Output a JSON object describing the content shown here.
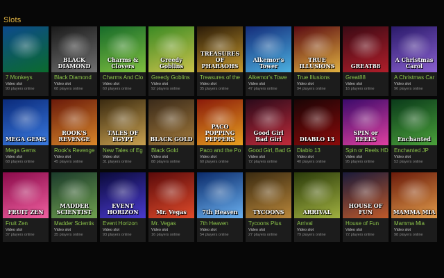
{
  "section_title": "Slots",
  "games": [
    {
      "name": "7 Monkeys",
      "logo": "",
      "type": "Video slot",
      "players": "90 players online",
      "bg": [
        "#0c4a8c",
        "#0b6b2d"
      ]
    },
    {
      "name": "Black Diamond",
      "logo": "BLACK DIAMOND",
      "type": "Video slot",
      "players": "68 players online",
      "bg": [
        "#1a1a1a",
        "#707070"
      ]
    },
    {
      "name": "Charms And Clo",
      "logo": "Charms & Clovers",
      "type": "Video slot",
      "players": "60 players online",
      "bg": [
        "#176b2a",
        "#7fbf3f"
      ]
    },
    {
      "name": "Greedy Goblins",
      "logo": "Greedy Goblins",
      "type": "Video slot",
      "players": "92 players online",
      "bg": [
        "#3b8a24",
        "#c9c24a"
      ]
    },
    {
      "name": "Treasures of the",
      "logo": "TREASURES OF PHARAOHS",
      "type": "Video slot",
      "players": "35 players online",
      "bg": [
        "#2a1a08",
        "#c79a2e"
      ]
    },
    {
      "name": "Alkemor's Towe",
      "logo": "Alkemor's Tower",
      "type": "Video slot",
      "players": "47 players online",
      "bg": [
        "#142c7a",
        "#4bb0e0"
      ]
    },
    {
      "name": "True Illusions",
      "logo": "TRUE ILLUSIONS",
      "type": "Video slot",
      "players": "94 players online",
      "bg": [
        "#5a0a12",
        "#e0b040"
      ]
    },
    {
      "name": "Great88",
      "logo": "GREAT88",
      "type": "Video slot",
      "players": "16 players online",
      "bg": [
        "#3a0a14",
        "#b01e2a"
      ]
    },
    {
      "name": "A Christmas Car",
      "logo": "A Christmas Carol",
      "type": "Video slot",
      "players": "96 players online",
      "bg": [
        "#2a1a6a",
        "#8a60d0"
      ]
    },
    {
      "name": "Mega Gems",
      "logo": "MEGA GEMS",
      "type": "Video slot",
      "players": "68 players online",
      "bg": [
        "#0a2a7a",
        "#3a7ae0"
      ]
    },
    {
      "name": "Rook's Revenge",
      "logo": "ROOK'S REVENGE",
      "type": "Video slot",
      "players": "45 players online",
      "bg": [
        "#6a1a0a",
        "#d8862a"
      ]
    },
    {
      "name": "New Tales of Eg",
      "logo": "TALES OF EGYPT",
      "type": "Video slot",
      "players": "31 players online",
      "bg": [
        "#3a2a10",
        "#c8a050"
      ]
    },
    {
      "name": "Black Gold",
      "logo": "BLACK GOLD",
      "type": "Video slot",
      "players": "88 players online",
      "bg": [
        "#3a2a1a",
        "#a0783a"
      ]
    },
    {
      "name": "Paco and the Po",
      "logo": "PACO POPPING PEPPERS",
      "type": "Video slot",
      "players": "60 players online",
      "bg": [
        "#8a1a0a",
        "#e8a020"
      ]
    },
    {
      "name": "Good Girl, Bad G",
      "logo": "Good Girl Bad Girl",
      "type": "Video slot",
      "players": "72 players online",
      "bg": [
        "#2a0a1a",
        "#c02a3a"
      ]
    },
    {
      "name": "Diablo 13",
      "logo": "DIABLO 13",
      "type": "Video slot",
      "players": "40 players online",
      "bg": [
        "#1a0506",
        "#8a0a0a"
      ]
    },
    {
      "name": "Spin or Reels HD",
      "logo": "SPIN or REELS",
      "type": "Video slot",
      "players": "95 players online",
      "bg": [
        "#3a0a6a",
        "#e040a0"
      ]
    },
    {
      "name": "Enchanted JP",
      "logo": "Enchanted",
      "type": "Video slot",
      "players": "53 players online",
      "bg": [
        "#0a3a1a",
        "#4aa03a"
      ]
    },
    {
      "name": "Fruit Zen",
      "logo": "FRUIT ZEN",
      "type": "Video slot",
      "players": "37 players online",
      "bg": [
        "#8a0a4a",
        "#f060a0"
      ]
    },
    {
      "name": "Madder Scientis",
      "logo": "MADDER SCIENTIST",
      "type": "Video slot",
      "players": "35 players online",
      "bg": [
        "#1a3a2a",
        "#70a050"
      ]
    },
    {
      "name": "Event Horizon",
      "logo": "EVENT HORIZON",
      "type": "Video slot",
      "players": "93 players online",
      "bg": [
        "#0a0a3a",
        "#4a3ad0"
      ]
    },
    {
      "name": "Mr. Vegas",
      "logo": "Mr. Vegas",
      "type": "Video slot",
      "players": "16 players online",
      "bg": [
        "#5a0a0a",
        "#e04a2a"
      ]
    },
    {
      "name": "7th Heaven",
      "logo": "7th Heaven",
      "type": "Video slot",
      "players": "54 players online",
      "bg": [
        "#0a2a6a",
        "#6ab0f0"
      ]
    },
    {
      "name": "Tycoons Plus",
      "logo": "TYCOONS",
      "type": "Video slot",
      "players": "27 players online",
      "bg": [
        "#3a2a10",
        "#b8863a"
      ]
    },
    {
      "name": "Arrival",
      "logo": "ARRIVAL",
      "type": "Video slot",
      "players": "79 players online",
      "bg": [
        "#2a3a0a",
        "#a0b040"
      ]
    },
    {
      "name": "House of Fun",
      "logo": "HOUSE OF FUN",
      "type": "Video slot",
      "players": "72 players online",
      "bg": [
        "#1a1a3a",
        "#c05a2a"
      ]
    },
    {
      "name": "Mamma Mia",
      "logo": "MAMMA MIA",
      "type": "Video slot",
      "players": "98 players online",
      "bg": [
        "#6a1a0a",
        "#e09a4a"
      ]
    }
  ]
}
